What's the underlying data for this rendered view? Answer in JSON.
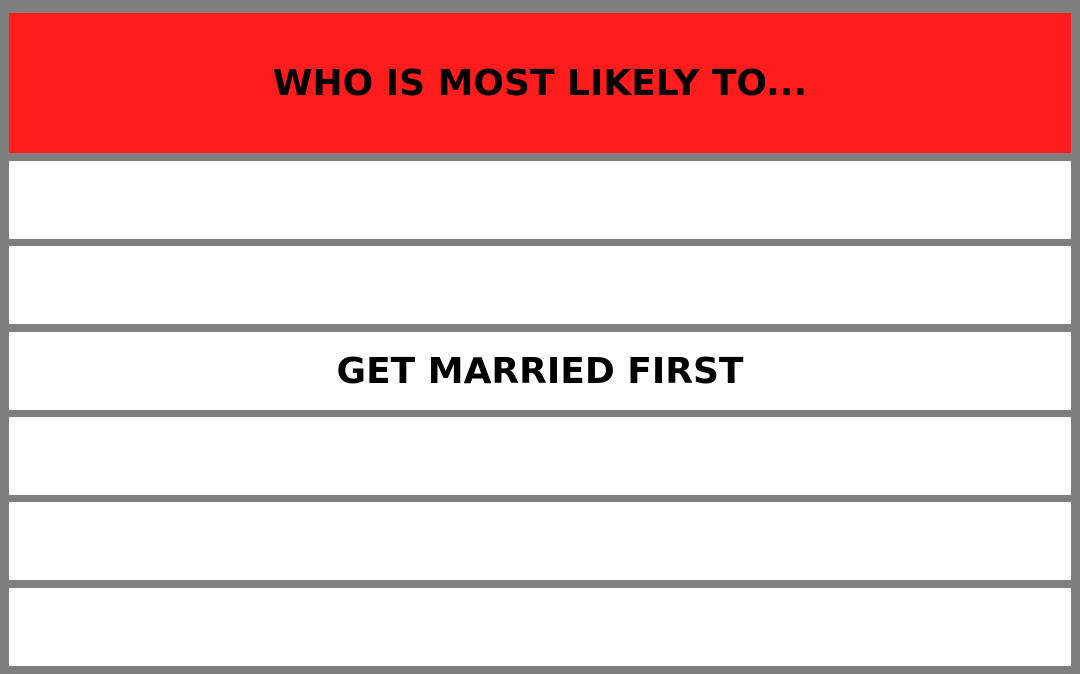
{
  "header": {
    "title": "WHO IS MOST LIKELY TO...",
    "background_color": "#ff1c1c"
  },
  "rows": [
    {
      "label": ""
    },
    {
      "label": ""
    },
    {
      "label": "GET MARRIED FIRST"
    },
    {
      "label": ""
    },
    {
      "label": ""
    },
    {
      "label": ""
    }
  ],
  "colors": {
    "border": "#7f7f7f",
    "row_background": "#ffffff",
    "text": "#000000"
  }
}
